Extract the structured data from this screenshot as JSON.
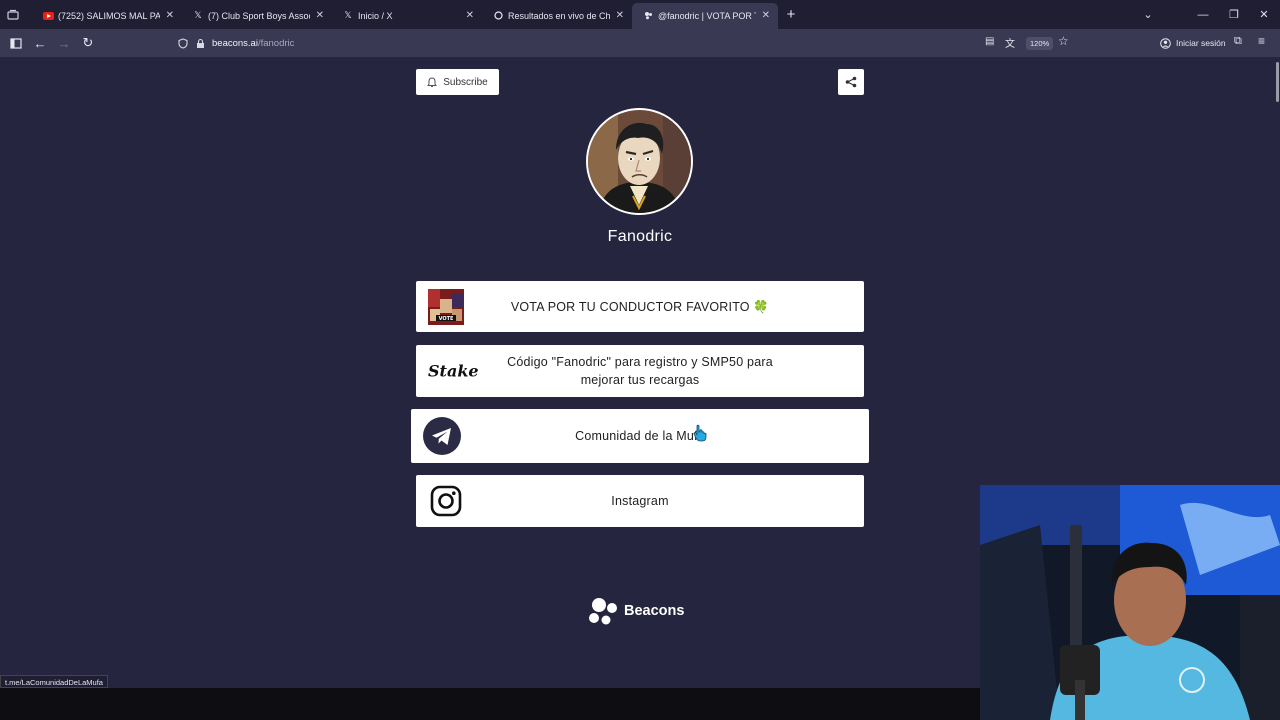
{
  "tabs": [
    {
      "title": "(7252) SALIMOS MAL PARADOS",
      "favicon": "youtube-icon",
      "active": false
    },
    {
      "title": "(7) Club Sport Boys Association",
      "favicon": "x-icon",
      "active": false
    },
    {
      "title": "Inicio / X",
      "favicon": "x-icon",
      "active": false
    },
    {
      "title": "Resultados en vivo de Champio",
      "favicon": "flashscore-icon",
      "active": false
    },
    {
      "title": "@fanodric | VOTA POR TU CON",
      "favicon": "beacons-icon",
      "active": true
    }
  ],
  "nav": {
    "url_host": "beacons.ai",
    "url_path": "/fanodric",
    "zoom": "120%",
    "signin": "Iniciar sesión"
  },
  "page": {
    "subscribe_label": "Subscribe",
    "profile_name": "Fanodric",
    "links": [
      {
        "text": "VOTA POR TU CONDUCTOR FAVORITO 🍀",
        "icon": "thumbnail-image"
      },
      {
        "text": "Código \"Fanodric\" para registro y  SMP50 para mejorar tus recargas",
        "icon": "stake-logo"
      },
      {
        "text": "Comunidad de la Mufa",
        "icon": "telegram-icon"
      },
      {
        "text": "Instagram",
        "icon": "instagram-icon"
      }
    ],
    "stake_logo_text": "Stake",
    "footer_brand": "Beacons"
  },
  "status_url": "t.me/LaComunidadDeLaMufa",
  "colors": {
    "page_bg": "#25253f",
    "tab_bar_bg": "#1f1e33",
    "toolbar_bg": "#3a3954",
    "card_bg": "#ffffff"
  }
}
